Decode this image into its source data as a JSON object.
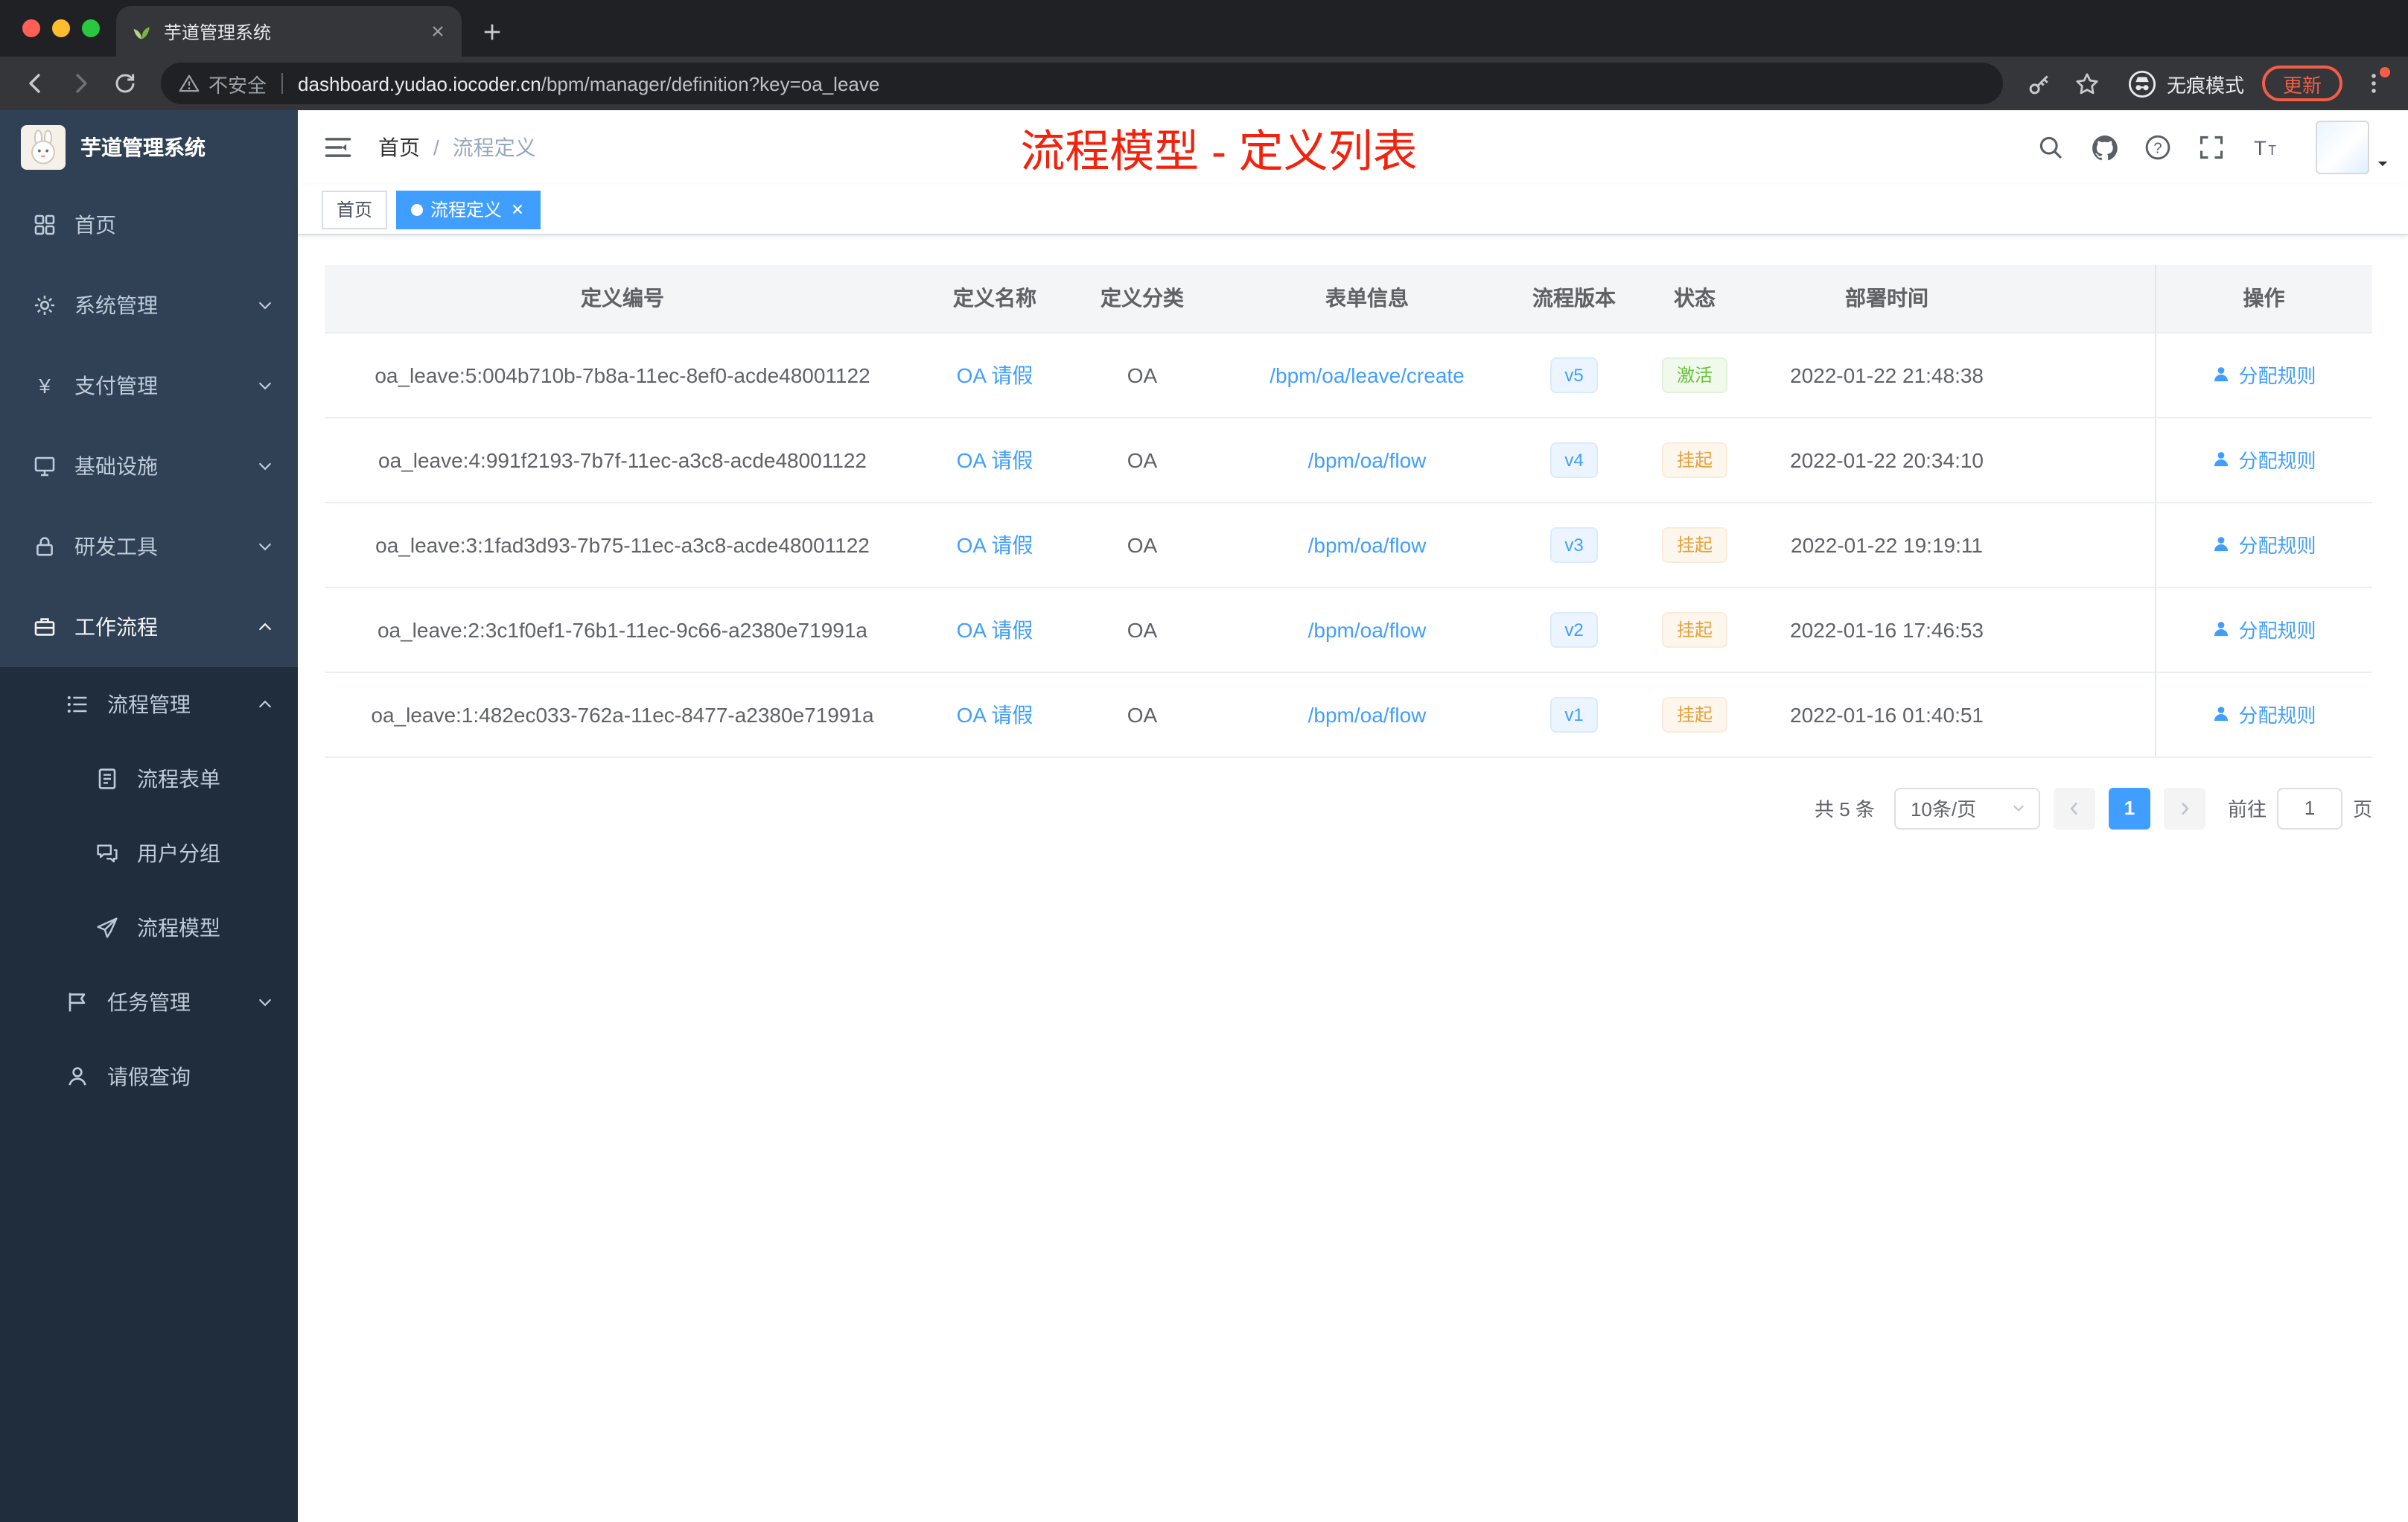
{
  "colors": {
    "primary": "#409eff",
    "success": "#67c23a",
    "warning": "#e6a23c",
    "annotation_red": "#f3220d",
    "sidebar_bg": "#304156",
    "submenu_bg": "#1f2d3d"
  },
  "browser": {
    "tab_title": "芋道管理系统",
    "security_label": "不安全",
    "url_domain": "dashboard.yudao.iocoder.cn",
    "url_path": "/bpm/manager/definition?key=oa_leave",
    "incognito_label": "无痕模式",
    "update_label": "更新"
  },
  "sidebar": {
    "logo_title": "芋道管理系统",
    "items": [
      {
        "label": "首页",
        "icon": "dashboard-icon",
        "level": 1
      },
      {
        "label": "系统管理",
        "icon": "gear-icon",
        "level": 1,
        "expandable": true
      },
      {
        "label": "支付管理",
        "icon": "yen-icon",
        "level": 1,
        "expandable": true
      },
      {
        "label": "基础设施",
        "icon": "infrastructure-icon",
        "level": 1,
        "expandable": true
      },
      {
        "label": "研发工具",
        "icon": "dev-tools-icon",
        "level": 1,
        "expandable": true
      },
      {
        "label": "工作流程",
        "icon": "workflow-icon",
        "level": 1,
        "expandable": true,
        "expanded": true,
        "active": true
      },
      {
        "label": "流程管理",
        "icon": "process-manage-icon",
        "level": 2,
        "expandable": true,
        "expanded": true
      },
      {
        "label": "流程表单",
        "icon": "form-icon",
        "level": 3
      },
      {
        "label": "用户分组",
        "icon": "user-group-icon",
        "level": 3
      },
      {
        "label": "流程模型",
        "icon": "process-model-icon",
        "level": 3
      },
      {
        "label": "任务管理",
        "icon": "task-manage-icon",
        "level": 2,
        "expandable": true
      },
      {
        "label": "请假查询",
        "icon": "leave-query-icon",
        "level": 2
      }
    ]
  },
  "header": {
    "breadcrumb_home": "首页",
    "breadcrumb_separator": "/",
    "breadcrumb_current": "流程定义",
    "overlay_title": "流程模型 - 定义列表"
  },
  "tags": [
    {
      "label": "首页",
      "active": false
    },
    {
      "label": "流程定义",
      "active": true
    }
  ],
  "table": {
    "columns": [
      "定义编号",
      "定义名称",
      "定义分类",
      "表单信息",
      "流程版本",
      "状态",
      "部署时间",
      "操作"
    ],
    "rows": [
      {
        "id": "oa_leave:5:004b710b-7b8a-11ec-8ef0-acde48001122",
        "name": "OA 请假",
        "category": "OA",
        "form": "/bpm/oa/leave/create",
        "version": "v5",
        "status": "激活",
        "status_type": "success",
        "time": "2022-01-22 21:48:38",
        "action": "分配规则"
      },
      {
        "id": "oa_leave:4:991f2193-7b7f-11ec-a3c8-acde48001122",
        "name": "OA 请假",
        "category": "OA",
        "form": "/bpm/oa/flow",
        "version": "v4",
        "status": "挂起",
        "status_type": "warning",
        "time": "2022-01-22 20:34:10",
        "action": "分配规则"
      },
      {
        "id": "oa_leave:3:1fad3d93-7b75-11ec-a3c8-acde48001122",
        "name": "OA 请假",
        "category": "OA",
        "form": "/bpm/oa/flow",
        "version": "v3",
        "status": "挂起",
        "status_type": "warning",
        "time": "2022-01-22 19:19:11",
        "action": "分配规则"
      },
      {
        "id": "oa_leave:2:3c1f0ef1-76b1-11ec-9c66-a2380e71991a",
        "name": "OA 请假",
        "category": "OA",
        "form": "/bpm/oa/flow",
        "version": "v2",
        "status": "挂起",
        "status_type": "warning",
        "time": "2022-01-16 17:46:53",
        "action": "分配规则"
      },
      {
        "id": "oa_leave:1:482ec033-762a-11ec-8477-a2380e71991a",
        "name": "OA 请假",
        "category": "OA",
        "form": "/bpm/oa/flow",
        "version": "v1",
        "status": "挂起",
        "status_type": "warning",
        "time": "2022-01-16 01:40:51",
        "action": "分配规则"
      }
    ]
  },
  "pagination": {
    "total": "共 5 条",
    "page_size": "10条/页",
    "current_page": "1",
    "goto_label": "前往",
    "goto_value": "1",
    "goto_suffix": "页"
  }
}
